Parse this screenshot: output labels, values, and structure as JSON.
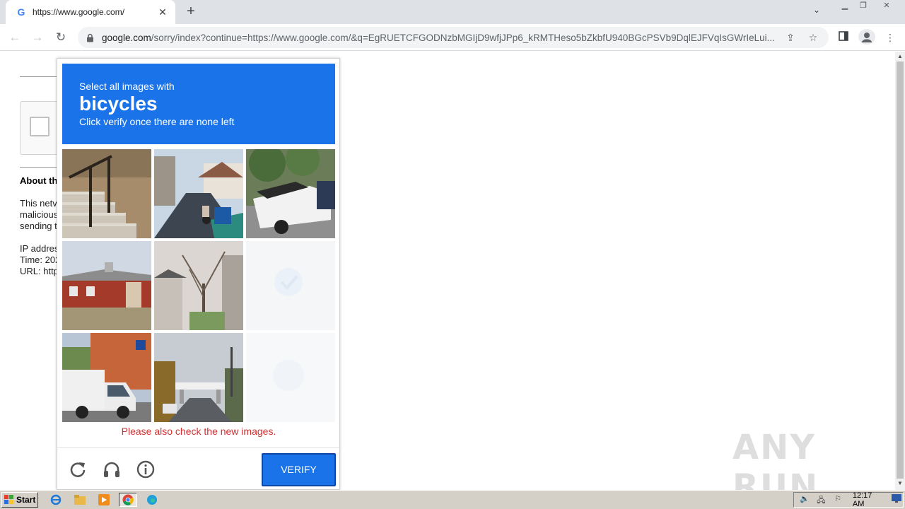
{
  "browser": {
    "tab_title": "https://www.google.com/",
    "tab_favicon": "G",
    "url_host": "google.com",
    "url_rest": "/sorry/index?continue=https://www.google.com/&q=EgRUETCFGODNzbMGIjD9wfjJPp6_kRMTHeso5bZkbfU940BGcPSVb9DqlEJFVqIsGWrIeLui..."
  },
  "page": {
    "about_heading": "About th",
    "about_lines": [
      "This netv",
      "malicious",
      "sending t"
    ],
    "info_lines": [
      "IP addres",
      "Time: 202",
      "URL: http"
    ]
  },
  "captcha": {
    "instruction_line1": "Select all images with",
    "target": "bicycles",
    "instruction_line2": "Click verify once there are none left",
    "error": "Please also check the new images.",
    "verify_label": "VERIFY",
    "tiles": [
      {
        "name": "tile-stairs",
        "state": "image"
      },
      {
        "name": "tile-street",
        "state": "image"
      },
      {
        "name": "tile-pickup-truck",
        "state": "image"
      },
      {
        "name": "tile-red-house",
        "state": "image"
      },
      {
        "name": "tile-tree-house",
        "state": "image"
      },
      {
        "name": "tile-fading",
        "state": "loading"
      },
      {
        "name": "tile-white-van",
        "state": "image"
      },
      {
        "name": "tile-bridge-road",
        "state": "image"
      },
      {
        "name": "tile-empty",
        "state": "loading"
      }
    ]
  },
  "watermark": "ANY RUN",
  "taskbar": {
    "start_label": "Start",
    "clock": "12:17 AM"
  },
  "colors": {
    "accent": "#1a73e8",
    "error": "#d32f2f"
  }
}
